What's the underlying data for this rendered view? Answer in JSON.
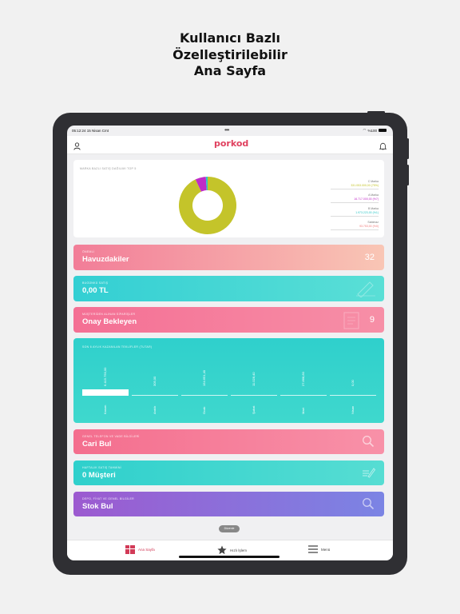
{
  "headline": [
    "Kullanıcı Bazlı",
    "Özelleştirilebilir",
    "Ana Sayfa"
  ],
  "status": {
    "time": "05:12:24  15 Nisan Cmt",
    "battery": "%100"
  },
  "app": {
    "logo": "porkod"
  },
  "brand_chart": {
    "title": "MARKA BAZLI SATIŞ DAĞILIMI TOP 5",
    "legend": [
      {
        "name": "C Marka",
        "value": "331.053.000,00 (75%)",
        "color": "#c4c42a"
      },
      {
        "name": "A Marka",
        "value": "16.717.000,00 (%7)",
        "color": "#c02bc8"
      },
      {
        "name": "B Marka",
        "value": "1.973.223,00 (%1)",
        "color": "#2cc6c6"
      },
      {
        "name": "Satılmaz",
        "value": "93.753,00 (%0)",
        "color": "#f07a7a"
      }
    ],
    "slices": [
      {
        "name": "C Marka",
        "value": 93,
        "color": "#c4c42a"
      },
      {
        "name": "A Marka",
        "value": 6,
        "color": "#c02bc8"
      },
      {
        "name": "B Marka",
        "value": 1,
        "color": "#2cc6c6"
      }
    ]
  },
  "cards": {
    "pool": {
      "small": "ÖNEMLİ",
      "big": "Havuzdakiler",
      "count": "32"
    },
    "today": {
      "small": "BUGÜNKÜ SATIŞ",
      "big": "0,00 TL"
    },
    "approval": {
      "small": "MÜŞTERİDEN ALINAN SİPARİŞLER",
      "big": "Onay Bekleyen",
      "count": "9"
    },
    "cari": {
      "small": "GENEL TELEFON VE VADE BİLGİLERİ",
      "big": "Cari Bul"
    },
    "weekly": {
      "small": "HAFTALIK SATIŞ TAHMİNİ",
      "big": "0 Müşteri"
    },
    "stock": {
      "small": "DEPO, FİYAT VE GENEL BİLGİLER",
      "big": "Stok Bul"
    }
  },
  "monthly_chart": {
    "title": "SON 6 AYLIK KAZANILAN TEKLİFLER (TUTAR)"
  },
  "chart_data": {
    "type": "bar",
    "title": "SON 6 AYLIK KAZANILAN TEKLİFLER (TUTAR)",
    "categories": [
      "Kasım",
      "Aralık",
      "Ocak",
      "Şubat",
      "Mart",
      "Nisan"
    ],
    "values": [
      6415750,
      305,
      154651.4,
      11028.4,
      27868.8,
      0
    ],
    "value_labels": [
      "6.415.750,00",
      "305,00",
      "154.651,40",
      "11.028,40",
      "27.868,80",
      "0,00"
    ]
  },
  "pill": "Düzenle",
  "tabs": [
    {
      "label": "Ana Sayfa",
      "icon": "home-grid-icon",
      "active": true
    },
    {
      "label": "Hızlı İşlem",
      "icon": "star-icon",
      "active": false
    },
    {
      "label": "Menü",
      "icon": "menu-icon",
      "active": false
    }
  ]
}
